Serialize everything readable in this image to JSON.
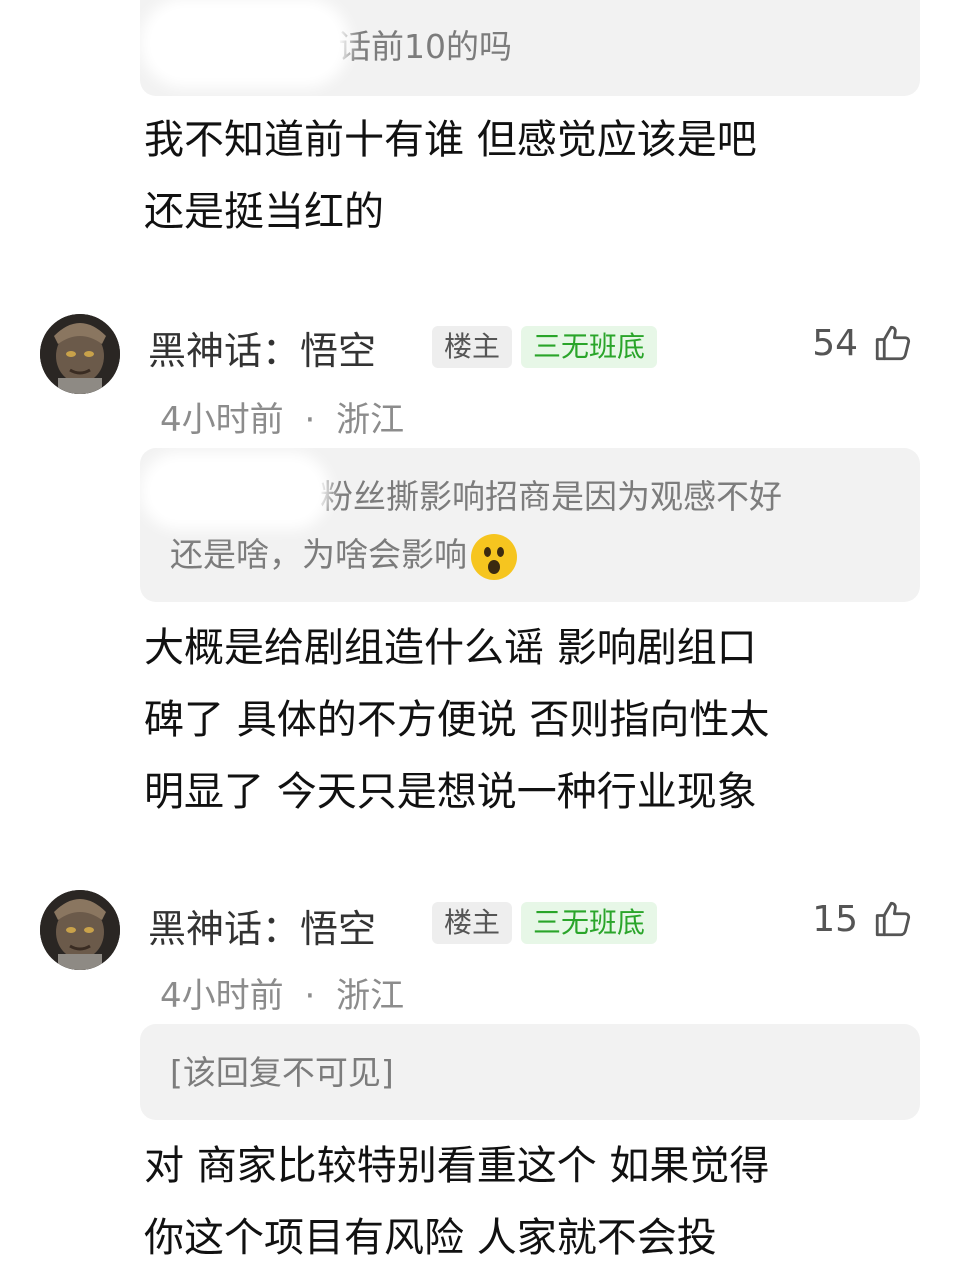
{
  "top_quote": {
    "text": "话前10的吗"
  },
  "reply1": {
    "lines": [
      "我不知道前十有谁 但感觉应该是吧",
      "还是挺当红的"
    ]
  },
  "comments": [
    {
      "username": "黑神话：悟空",
      "owner_badge": "楼主",
      "fan_badge": "三无班底",
      "likes": "54",
      "time": "4小时前",
      "location": "浙江",
      "quote_lines": [
        "粉丝撕影响招商是因为观感不好",
        "还是啥，为啥会影响"
      ],
      "quote_emoji": "astonished-face",
      "reply_lines": [
        "大概是给剧组造什么谣 影响剧组口",
        "碑了 具体的不方便说 否则指向性太",
        "明显了 今天只是想说一种行业现象"
      ]
    },
    {
      "username": "黑神话：悟空",
      "owner_badge": "楼主",
      "fan_badge": "三无班底",
      "likes": "15",
      "time": "4小时前",
      "location": "浙江",
      "quote_lines": [
        "[该回复不可见]"
      ],
      "reply_lines": [
        "对 商家比较特别看重这个 如果觉得",
        "你这个项目有风险 人家就不会投"
      ]
    }
  ],
  "separator": "·",
  "colors": {
    "fan_badge": "#2aa52a",
    "quote_bg": "#f2f2f2",
    "meta": "#8c8c8c"
  },
  "icons": {
    "like": "thumbs-up-icon",
    "avatar": "wukong-avatar"
  }
}
